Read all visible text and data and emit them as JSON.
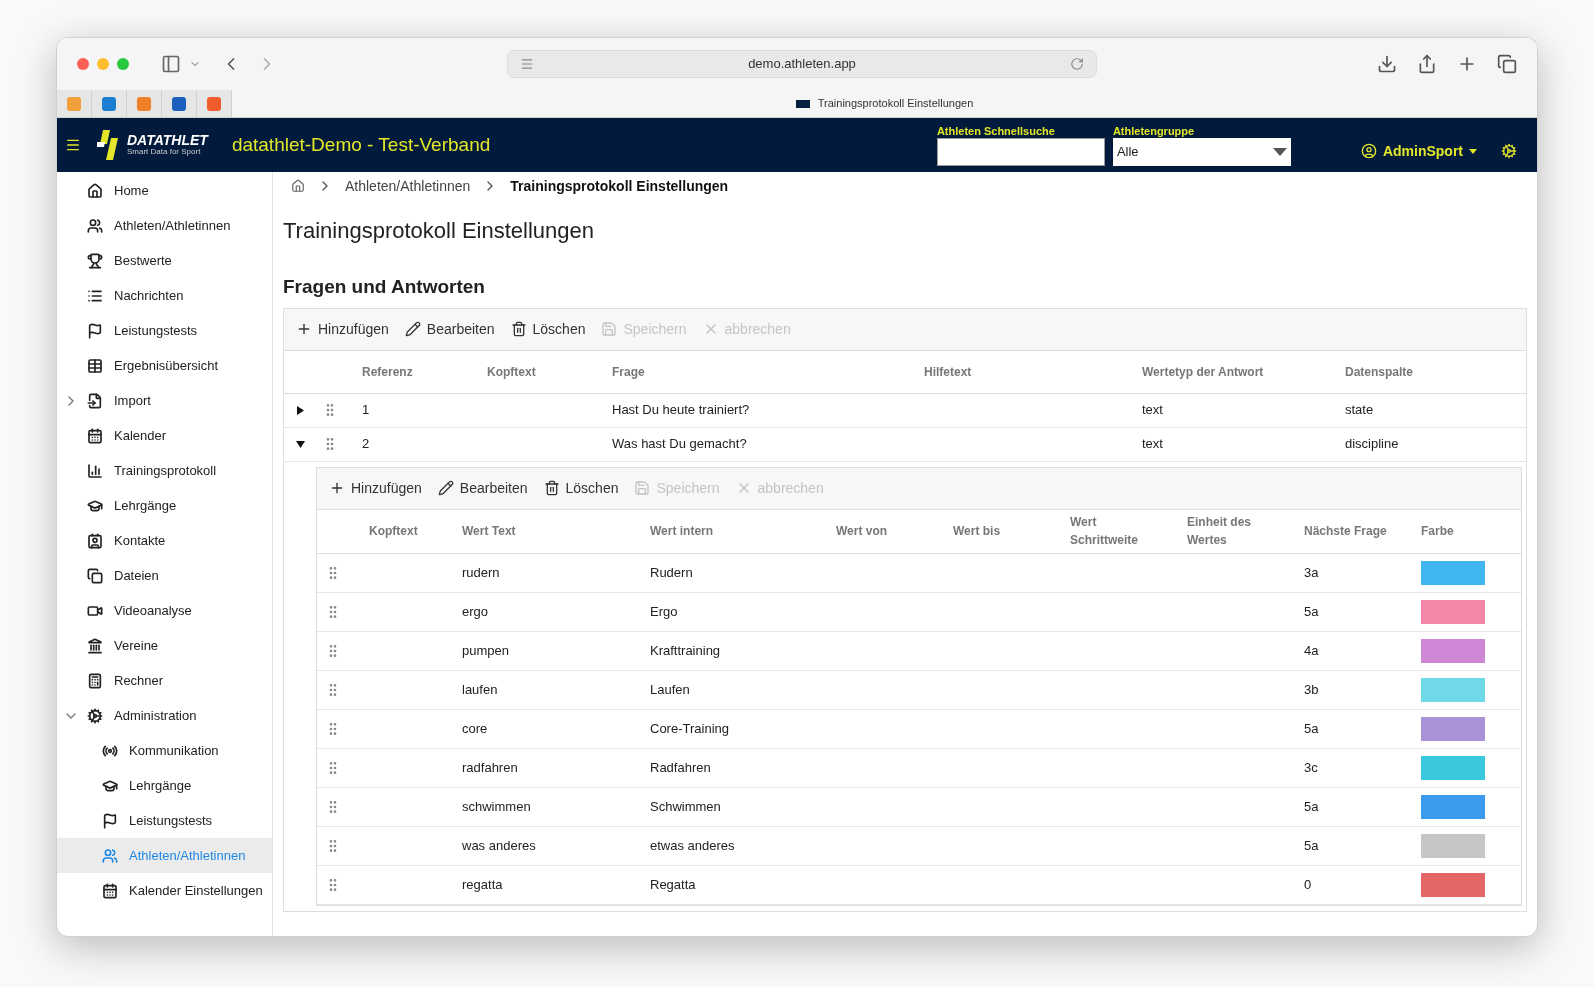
{
  "browser": {
    "url": "demo.athleten.app",
    "tab_title": "Trainingsprotokoll Einstellungen"
  },
  "header": {
    "brand": "DATATHLET",
    "tagline": "Smart Data for Sport",
    "app_title": "datathlet-Demo - Test-Verband",
    "search": {
      "label": "Athleten Schnellsuche"
    },
    "group": {
      "label": "Athletengruppe",
      "value": "Alle"
    },
    "user": "AdminSport"
  },
  "sidebar": {
    "items": [
      {
        "label": "Home",
        "kind": "link",
        "selected": false
      },
      {
        "label": "Athleten/Athletinnen",
        "kind": "link",
        "selected": false
      },
      {
        "label": "Bestwerte",
        "kind": "link",
        "selected": false
      },
      {
        "label": "Nachrichten",
        "kind": "link",
        "selected": false
      },
      {
        "label": "Leistungstests",
        "kind": "link",
        "selected": false
      },
      {
        "label": "Ergebnisübersicht",
        "kind": "link",
        "selected": false
      },
      {
        "label": "Import",
        "kind": "group",
        "expanded": false,
        "selected": false
      },
      {
        "label": "Kalender",
        "kind": "link",
        "selected": false
      },
      {
        "label": "Trainingsprotokoll",
        "kind": "link",
        "selected": false
      },
      {
        "label": "Lehrgänge",
        "kind": "link",
        "selected": false
      },
      {
        "label": "Kontakte",
        "kind": "link",
        "selected": false
      },
      {
        "label": "Dateien",
        "kind": "link",
        "selected": false
      },
      {
        "label": "Videoanalyse",
        "kind": "link",
        "selected": false
      },
      {
        "label": "Vereine",
        "kind": "link",
        "selected": false
      },
      {
        "label": "Rechner",
        "kind": "link",
        "selected": false
      },
      {
        "label": "Administration",
        "kind": "group",
        "expanded": true,
        "selected": false,
        "children": [
          {
            "label": "Kommunikation",
            "selected": false
          },
          {
            "label": "Lehrgänge",
            "selected": false
          },
          {
            "label": "Leistungstests",
            "selected": false
          },
          {
            "label": "Athleten/Athletinnen",
            "selected": true
          },
          {
            "label": "Kalender Einstellungen",
            "selected": false
          }
        ]
      }
    ]
  },
  "breadcrumb": [
    "Athleten/Athletinnen",
    "Trainingsprotokoll Einstellungen"
  ],
  "page_title": "Trainingsprotokoll Einstellungen",
  "section_title": "Fragen und Antworten",
  "questions": {
    "toolbar": [
      {
        "label": "Hinzufügen",
        "disabled": false
      },
      {
        "label": "Bearbeiten",
        "disabled": false
      },
      {
        "label": "Löschen",
        "disabled": false
      },
      {
        "label": "Speichern",
        "disabled": true
      },
      {
        "label": "abbrechen",
        "disabled": true
      }
    ],
    "columns": [
      "Referenz",
      "Kopftext",
      "Frage",
      "Hilfetext",
      "Wertetyp der Antwort",
      "Datenspalte"
    ],
    "rows": [
      {
        "reference": "1",
        "question": "Hast Du heute trainiert?",
        "answer_type": "text",
        "data_column": "state",
        "expanded": false
      },
      {
        "reference": "2",
        "question": "Was hast Du gemacht?",
        "answer_type": "text",
        "data_column": "discipline",
        "expanded": true,
        "answers": {
          "toolbar": [
            {
              "label": "Hinzufügen",
              "disabled": false
            },
            {
              "label": "Bearbeiten",
              "disabled": false
            },
            {
              "label": "Löschen",
              "disabled": false
            },
            {
              "label": "Speichern",
              "disabled": true
            },
            {
              "label": "abbrechen",
              "disabled": true
            }
          ],
          "columns": [
            "Kopftext",
            "Wert Text",
            "Wert intern",
            "Wert von",
            "Wert bis",
            "Wert Schrittweite",
            "Einheit des Wertes",
            "Nächste Frage",
            "Farbe"
          ],
          "rows": [
            {
              "value_text": "rudern",
              "value_internal": "Rudern",
              "next_question": "3a",
              "color": "#3fb6f0"
            },
            {
              "value_text": "ergo",
              "value_internal": "Ergo",
              "next_question": "5a",
              "color": "#f287a8"
            },
            {
              "value_text": "pumpen",
              "value_internal": "Krafttraining",
              "next_question": "4a",
              "color": "#cd87d5"
            },
            {
              "value_text": "laufen",
              "value_internal": "Laufen",
              "next_question": "3b",
              "color": "#6fd9e8"
            },
            {
              "value_text": "core",
              "value_internal": "Core-Training",
              "next_question": "5a",
              "color": "#ab92d6"
            },
            {
              "value_text": "radfahren",
              "value_internal": "Radfahren",
              "next_question": "3c",
              "color": "#38c7dc"
            },
            {
              "value_text": "schwimmen",
              "value_internal": "Schwimmen",
              "next_question": "5a",
              "color": "#3a9bee"
            },
            {
              "value_text": "was anderes",
              "value_internal": "etwas anderes",
              "next_question": "5a",
              "color": "#c6c6c6"
            },
            {
              "value_text": "regatta",
              "value_internal": "Regatta",
              "next_question": "0",
              "color": "#e36766"
            }
          ]
        }
      }
    ]
  }
}
